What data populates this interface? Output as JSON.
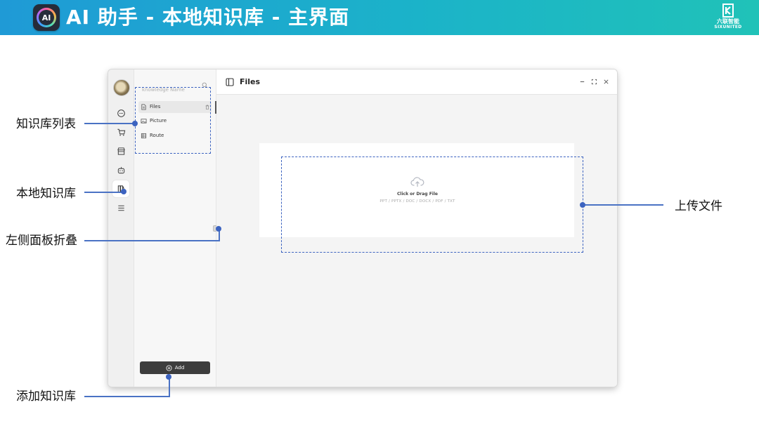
{
  "slide": {
    "title": "AI 助手 - 本地知识库 - 主界面",
    "app_logo_text": "AI",
    "brand_cn": "六联智能",
    "brand_en": "SIXUNITED"
  },
  "annotations": {
    "kb_list": "知识库列表",
    "local_kb": "本地知识库",
    "collapse_panel": "左侧面板折叠",
    "add_kb": "添加知识库",
    "upload_file": "上传文件"
  },
  "window": {
    "title": "Files",
    "search_placeholder": "knowledge Name",
    "knowledge_bases": [
      {
        "label": "Files",
        "icon": "file-icon",
        "active": true
      },
      {
        "label": "Picture",
        "icon": "image-icon",
        "active": false
      },
      {
        "label": "Route",
        "icon": "table-icon",
        "active": false
      }
    ],
    "add_label": "Add",
    "upload": {
      "title": "Click or Drag File",
      "formats": "PPT / PPTX / DOC / DOCX / PDF / TXT"
    },
    "rail_icons": [
      "chat-icon",
      "cart-icon",
      "store-icon",
      "robot-icon",
      "knowledge-base-icon",
      "menu-icon"
    ],
    "active_rail": "knowledge-base-icon"
  },
  "colors": {
    "banner_start": "#1f9ad6",
    "banner_end": "#20c2b8",
    "annotation_line": "#4a72c4",
    "add_button": "#3d3d3d"
  }
}
